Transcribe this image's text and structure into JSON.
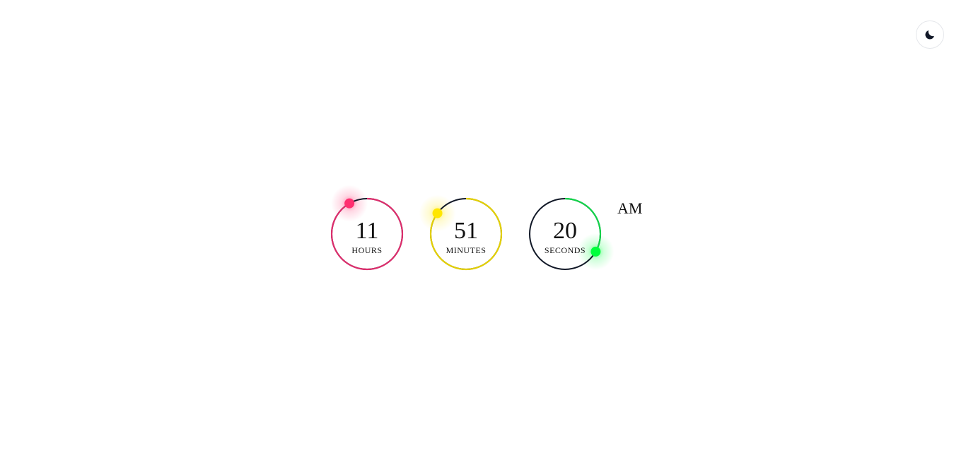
{
  "theme_toggle": {
    "icon": "moon-icon"
  },
  "clock": {
    "hours": {
      "value": "11",
      "label": "HOURS",
      "progress": 0.917,
      "color": "#dd2d6c",
      "dot_color": "#ff2f70"
    },
    "minutes": {
      "value": "51",
      "label": "MINUTES",
      "progress": 0.85,
      "color": "#e4d000",
      "dot_color": "#ffe600"
    },
    "seconds": {
      "value": "20",
      "label": "SECONDS",
      "progress": 0.333,
      "color": "#12d34a",
      "dot_color": "#00ff3c"
    },
    "meridiem": "AM",
    "track_color": "#111827"
  }
}
